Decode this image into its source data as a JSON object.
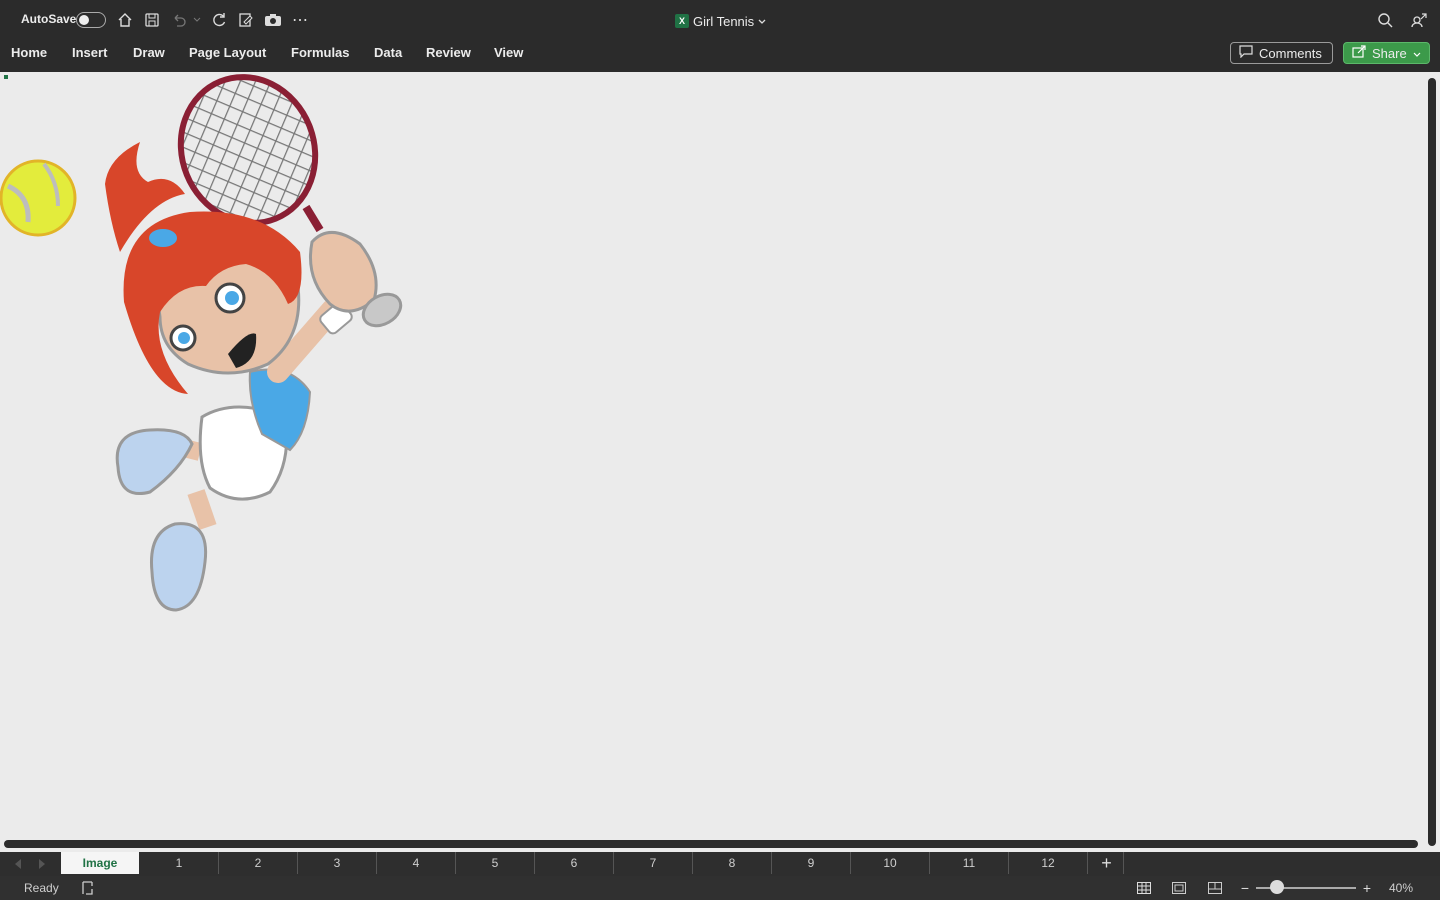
{
  "titlebar": {
    "autosave_label": "AutoSave",
    "document_title": "Girl Tennis",
    "icons": [
      "home-icon",
      "save-icon",
      "undo-icon",
      "redo-icon",
      "refresh-icon",
      "edit-icon",
      "camera-icon",
      "more-icon",
      "search-icon",
      "share-person-icon"
    ]
  },
  "ribbon": {
    "menus": [
      "Home",
      "Insert",
      "Draw",
      "Page Layout",
      "Formulas",
      "Data",
      "Review",
      "View"
    ],
    "comments_label": "Comments",
    "share_label": "Share"
  },
  "sheets": {
    "active": "Image",
    "others": [
      "1",
      "2",
      "3",
      "4",
      "5",
      "6",
      "7",
      "8",
      "9",
      "10",
      "11",
      "12"
    ]
  },
  "status": {
    "ready": "Ready",
    "zoom": "40%",
    "zoom_value": 0.4
  },
  "colors": {
    "chrome": "#2b2b2b",
    "sheet_bg": "#ebebeb",
    "share_green": "#3c9a4a",
    "excel_green": "#207245"
  }
}
